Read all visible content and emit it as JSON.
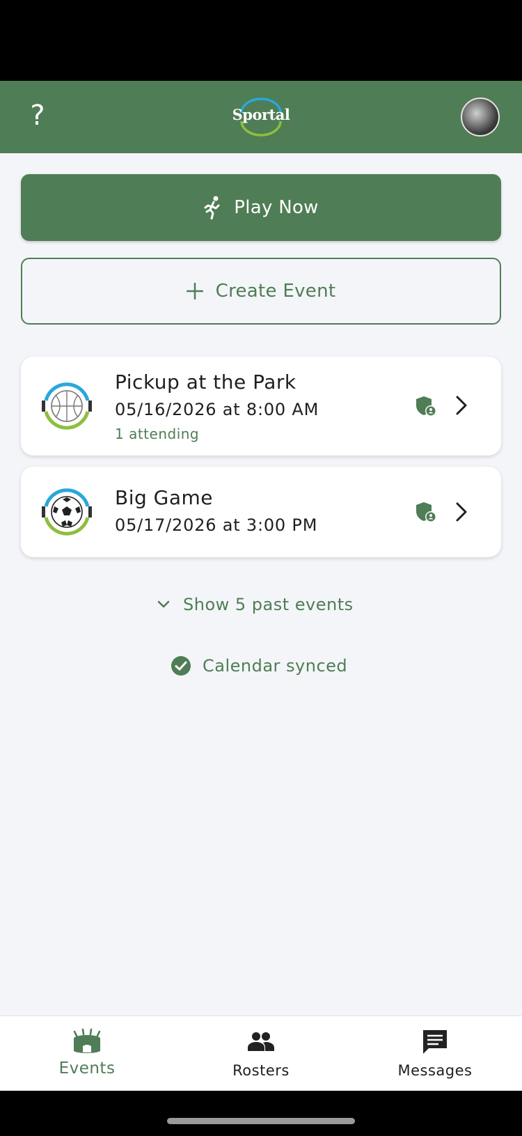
{
  "app": {
    "logo_text": "Sportal",
    "help_label": "?",
    "brand_color": "#4f7d55"
  },
  "actions": {
    "play_now_label": "Play Now",
    "create_event_label": "Create Event"
  },
  "events": [
    {
      "title": "Pickup at the Park",
      "datetime": "05/16/2026 at 8:00 AM",
      "attending": "1 attending",
      "sport_icon": "basketball-icon",
      "privacy_icon": "shield-person-icon"
    },
    {
      "title": "Big Game",
      "datetime": "05/17/2026 at 3:00 PM",
      "sport_icon": "soccer-ball-icon",
      "privacy_icon": "shield-person-icon"
    }
  ],
  "past_events_label": "Show 5 past events",
  "calendar_status": "Calendar synced",
  "tabs": [
    {
      "label": "Events",
      "icon": "stadium-icon",
      "active": true
    },
    {
      "label": "Rosters",
      "icon": "people-icon",
      "active": false
    },
    {
      "label": "Messages",
      "icon": "chat-icon",
      "active": false
    }
  ]
}
